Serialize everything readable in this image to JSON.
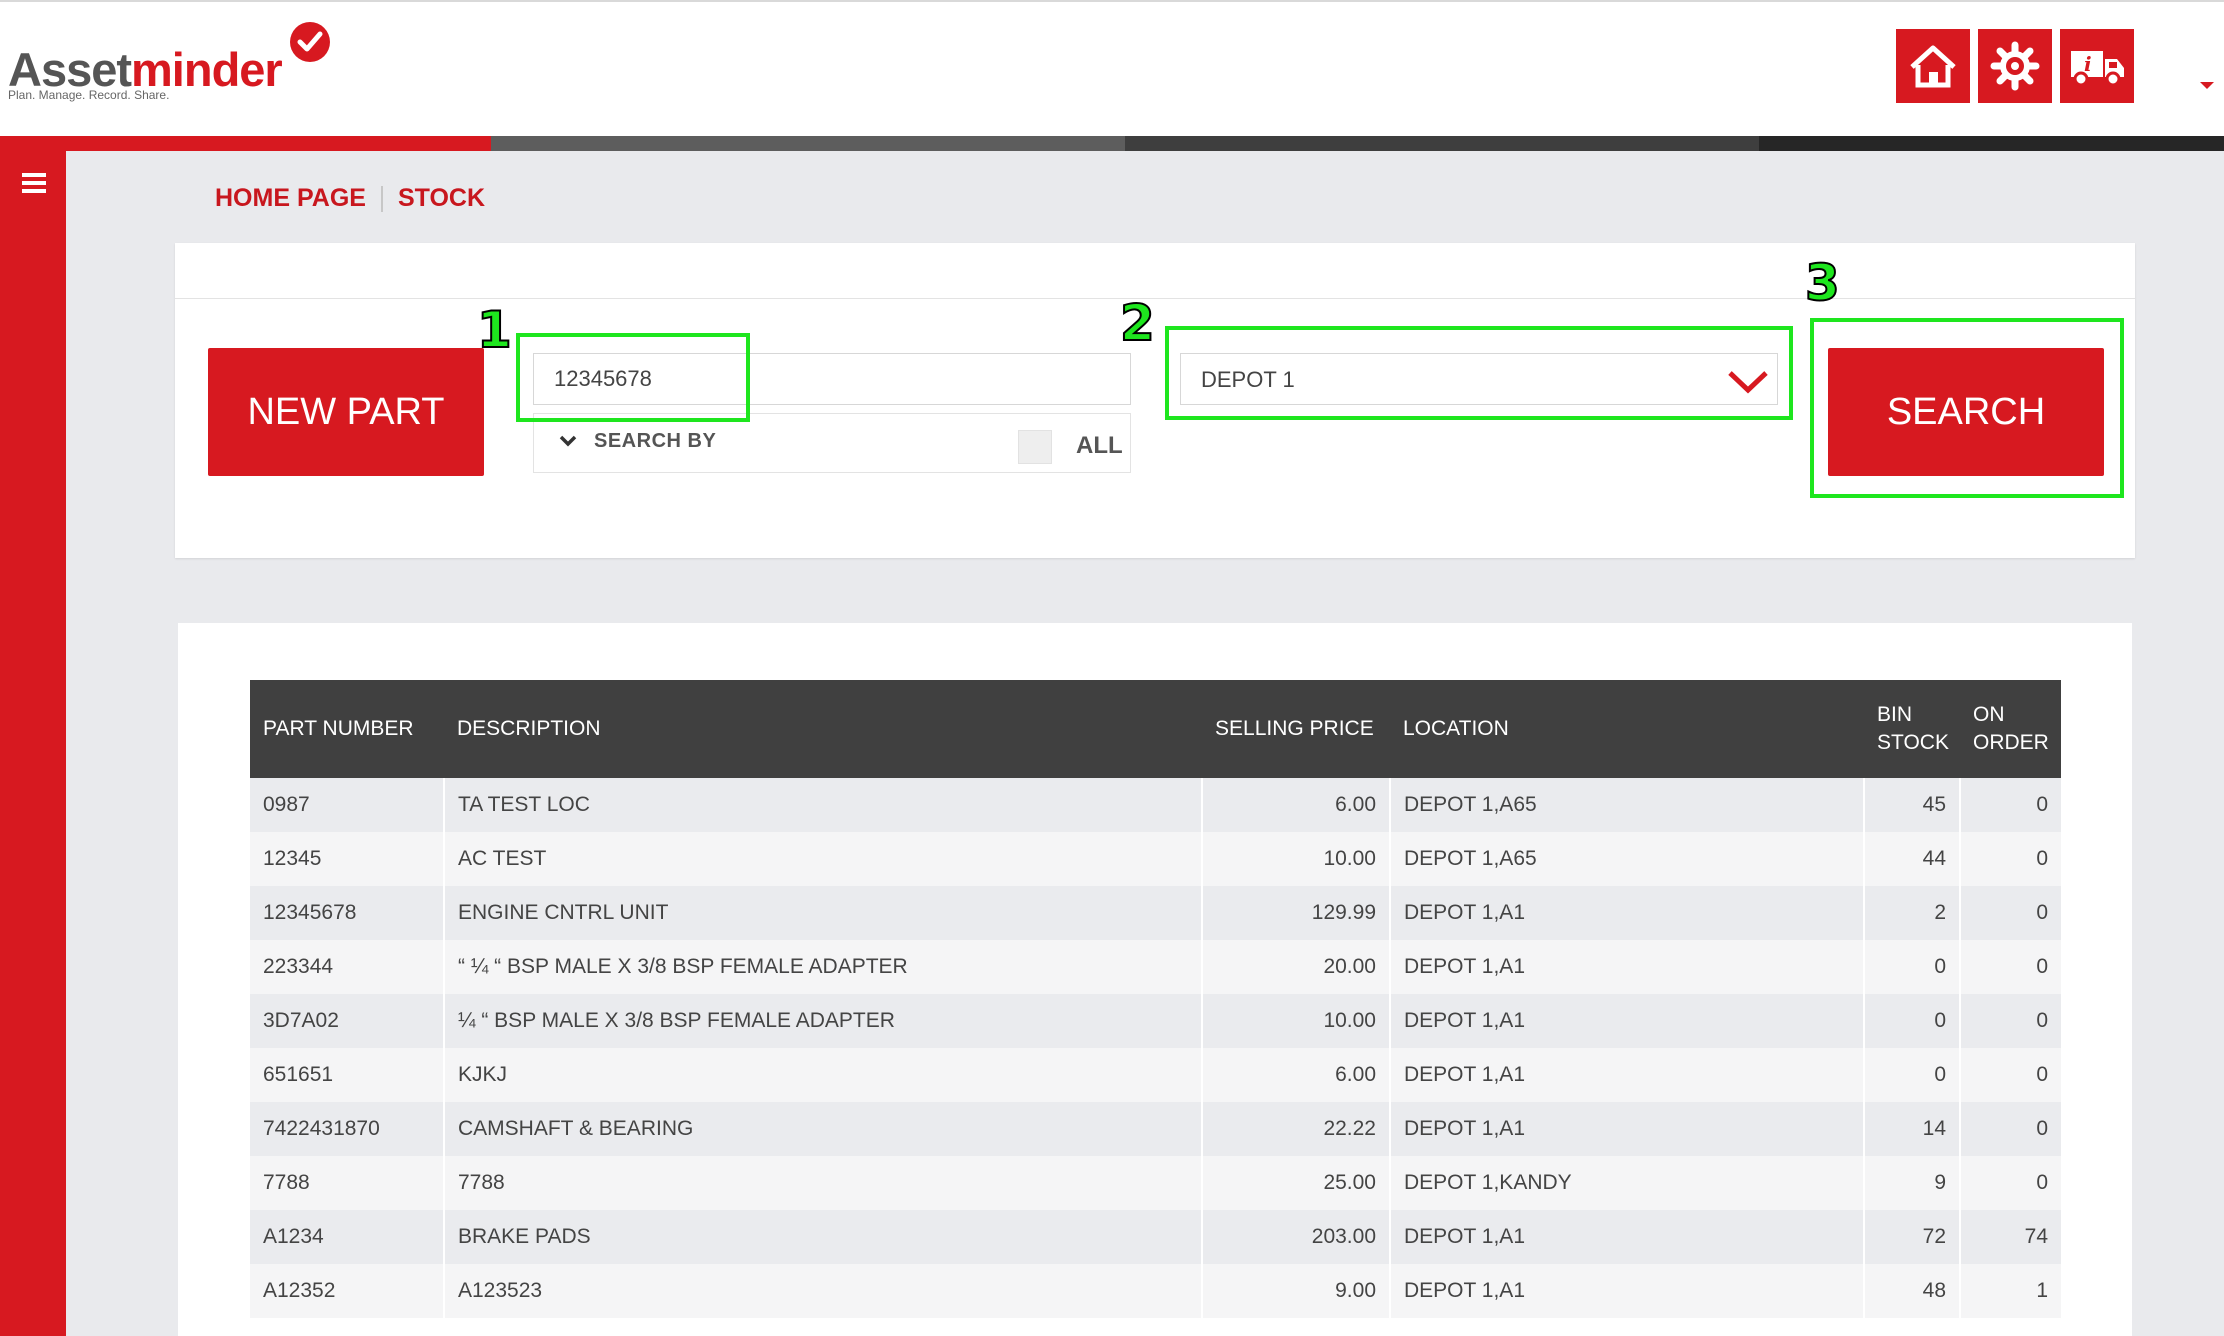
{
  "app": {
    "logo_part1": "Asset",
    "logo_part2": "minder",
    "tagline": "Plan. Manage. Record. Share."
  },
  "header_icons": [
    "home-icon",
    "settings-gear-icon",
    "info-truck-icon"
  ],
  "colors": {
    "brand_red": "#d71920",
    "header_dark": "#404040",
    "annotation_green": "#1ee61e"
  },
  "breadcrumb": {
    "home": "HOME PAGE",
    "current": "STOCK"
  },
  "search": {
    "new_part_label": "NEW PART",
    "part_number_value": "12345678",
    "search_by_label": "SEARCH BY",
    "all_label": "ALL",
    "depot_value": "DEPOT 1",
    "search_label": "SEARCH"
  },
  "annotations": [
    "1",
    "2",
    "3"
  ],
  "table": {
    "columns": {
      "part_number": "PART NUMBER",
      "description": "DESCRIPTION",
      "selling_price": "SELLING PRICE",
      "location": "LOCATION",
      "bin_stock_1": "BIN",
      "bin_stock_2": "STOCK",
      "on_order_1": "ON",
      "on_order_2": "ORDER"
    },
    "rows": [
      {
        "part": "0987",
        "desc": "TA TEST LOC",
        "price": "6.00",
        "loc": "DEPOT 1,A65",
        "bin": "45",
        "order": "0"
      },
      {
        "part": "12345",
        "desc": "AC TEST",
        "price": "10.00",
        "loc": "DEPOT 1,A65",
        "bin": "44",
        "order": "0"
      },
      {
        "part": "12345678",
        "desc": "ENGINE CNTRL UNIT",
        "price": "129.99",
        "loc": "DEPOT 1,A1",
        "bin": "2",
        "order": "0"
      },
      {
        "part": "223344",
        "desc": "“ ¼ “ BSP MALE X 3/8 BSP FEMALE ADAPTER",
        "price": "20.00",
        "loc": "DEPOT 1,A1",
        "bin": "0",
        "order": "0"
      },
      {
        "part": "3D7A02",
        "desc": "¼ “ BSP MALE X 3/8 BSP FEMALE ADAPTER",
        "price": "10.00",
        "loc": "DEPOT 1,A1",
        "bin": "0",
        "order": "0"
      },
      {
        "part": "651651",
        "desc": "KJKJ",
        "price": "6.00",
        "loc": "DEPOT 1,A1",
        "bin": "0",
        "order": "0"
      },
      {
        "part": "7422431870",
        "desc": "CAMSHAFT & BEARING",
        "price": "22.22",
        "loc": "DEPOT 1,A1",
        "bin": "14",
        "order": "0"
      },
      {
        "part": "7788",
        "desc": "7788",
        "price": "25.00",
        "loc": "DEPOT 1,KANDY",
        "bin": "9",
        "order": "0"
      },
      {
        "part": "A1234",
        "desc": "BRAKE PADS",
        "price": "203.00",
        "loc": "DEPOT 1,A1",
        "bin": "72",
        "order": "74"
      },
      {
        "part": "A12352",
        "desc": "A123523",
        "price": "9.00",
        "loc": "DEPOT 1,A1",
        "bin": "48",
        "order": "1"
      }
    ]
  }
}
